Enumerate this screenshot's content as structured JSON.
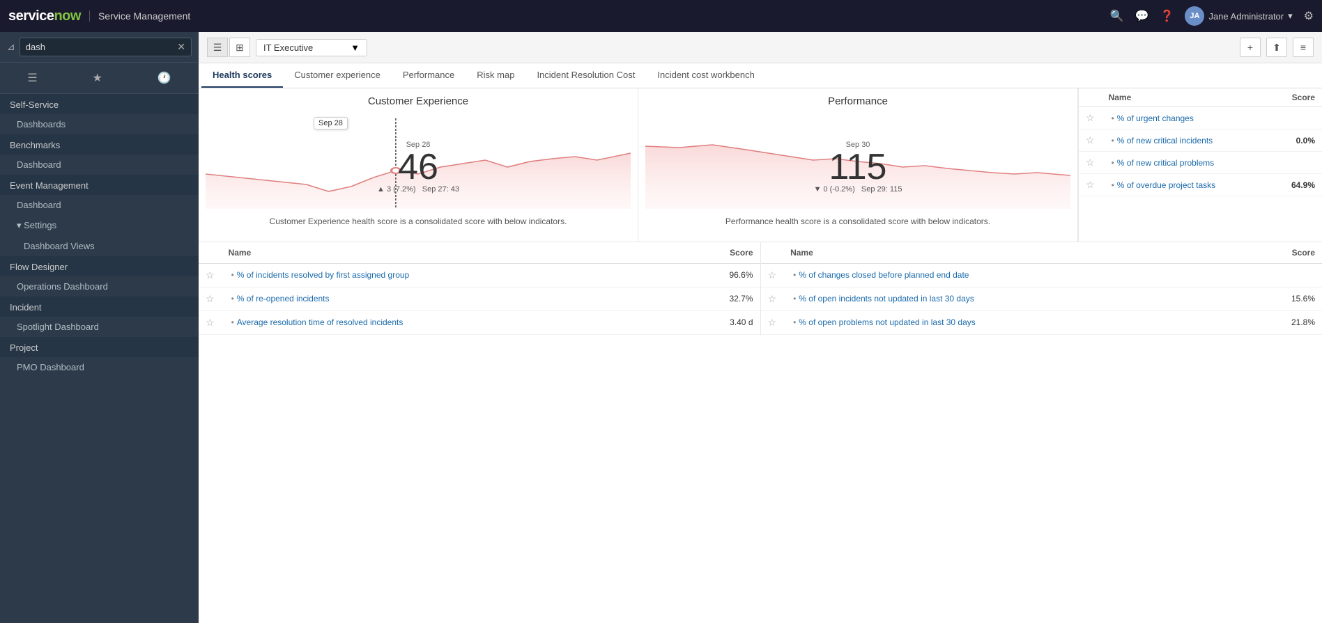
{
  "topbar": {
    "logo": "serviceNow",
    "logo_accent": "now",
    "app_title": "Service Management",
    "user_name": "Jane Administrator",
    "user_initials": "JA",
    "icons": {
      "search": "🔍",
      "chat": "💬",
      "help": "?",
      "settings": "⚙"
    }
  },
  "sidebar": {
    "search_placeholder": "dash",
    "search_value": "dash",
    "nav_icons": [
      "☰",
      "★",
      "🕐"
    ],
    "sections": [
      {
        "label": "Self-Service",
        "type": "header"
      },
      {
        "label": "Dashboards",
        "type": "item",
        "indent": 1
      },
      {
        "label": "Benchmarks",
        "type": "header"
      },
      {
        "label": "Dashboard",
        "type": "item",
        "indent": 1
      },
      {
        "label": "Event Management",
        "type": "header"
      },
      {
        "label": "Dashboard",
        "type": "item",
        "indent": 1
      },
      {
        "label": "Settings",
        "type": "item",
        "indent": 1,
        "has_arrow": true
      },
      {
        "label": "Dashboard Views",
        "type": "sub-item"
      },
      {
        "label": "Flow Designer",
        "type": "header"
      },
      {
        "label": "Operations Dashboard",
        "type": "item",
        "indent": 1
      },
      {
        "label": "Incident",
        "type": "header"
      },
      {
        "label": "Spotlight Dashboard",
        "type": "item",
        "indent": 1
      },
      {
        "label": "Project",
        "type": "header"
      },
      {
        "label": "PMO Dashboard",
        "type": "item",
        "indent": 1
      }
    ]
  },
  "toolbar": {
    "view_list_label": "☰",
    "view_grid_label": "⊞",
    "dashboard_selected": "IT Executive",
    "dropdown_icon": "▼",
    "add_icon": "+",
    "share_icon": "⬆",
    "settings_icon": "≡"
  },
  "tabs": [
    {
      "label": "Health scores",
      "active": true
    },
    {
      "label": "Customer experience",
      "active": false
    },
    {
      "label": "Performance",
      "active": false
    },
    {
      "label": "Risk map",
      "active": false
    },
    {
      "label": "Incident Resolution Cost",
      "active": false
    },
    {
      "label": "Incident cost workbench",
      "active": false
    }
  ],
  "charts": {
    "customer_experience": {
      "title": "Customer Experience",
      "date": "Sep 28",
      "value": "46",
      "delta": "▲ 3 (7.2%)",
      "delta_date": "Sep 27: 43",
      "description": "Customer Experience health score is a consolidated score with below indicators.",
      "chart_color": "#e8a0a0",
      "chart_fill": "#fde8e8"
    },
    "performance": {
      "title": "Performance",
      "date": "Sep 30",
      "value": "115",
      "delta": "▼ 0 (-0.2%)",
      "delta_date": "Sep 29: 115",
      "description": "Performance health score is a consolidated score with below indicators.",
      "chart_color": "#e8a0a0",
      "chart_fill": "#fde8e8"
    }
  },
  "scores_panel": {
    "col_name": "Name",
    "col_score": "Score",
    "rows": [
      {
        "name": "% of urgent changes",
        "score": "",
        "score_color": "normal",
        "star": false
      },
      {
        "name": "% of new critical incidents",
        "score": "0.0%",
        "score_color": "normal",
        "star": false
      },
      {
        "name": "% of new critical problems",
        "score": "",
        "score_color": "normal",
        "star": false
      },
      {
        "name": "% of overdue project tasks",
        "score": "64.9%",
        "score_color": "red",
        "star": false
      }
    ]
  },
  "lower_tables": [
    {
      "col_name": "Name",
      "col_score": "Score",
      "rows": [
        {
          "name": "% of incidents resolved by first assigned group",
          "score": "96.6%",
          "score_color": "normal"
        },
        {
          "name": "% of re-opened incidents",
          "score": "32.7%",
          "score_color": "red"
        },
        {
          "name": "Average resolution time of resolved incidents",
          "score": "3.40 d",
          "score_color": "normal"
        }
      ]
    },
    {
      "col_name": "Name",
      "col_score": "Score",
      "rows": [
        {
          "name": "% of changes closed before planned end date",
          "score": "",
          "score_color": "normal"
        },
        {
          "name": "% of open incidents not updated in last 30 days",
          "score": "15.6%",
          "score_color": "red"
        },
        {
          "name": "% of open problems not updated in last 30 days",
          "score": "21.8%",
          "score_color": "red"
        }
      ]
    }
  ],
  "cursor_tooltip": "Sep 28"
}
